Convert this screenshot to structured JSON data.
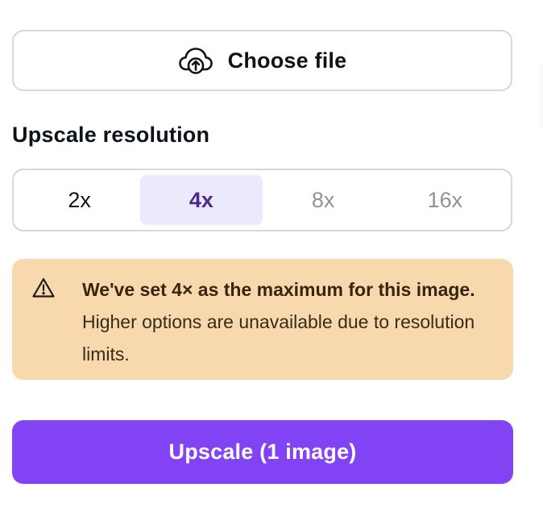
{
  "upload": {
    "choose_file_label": "Choose file",
    "icon": "cloud-upload-icon"
  },
  "resolution": {
    "title": "Upscale resolution",
    "options": [
      {
        "label": "2x",
        "state": "enabled"
      },
      {
        "label": "4x",
        "state": "selected"
      },
      {
        "label": "8x",
        "state": "disabled"
      },
      {
        "label": "16x",
        "state": "disabled"
      }
    ]
  },
  "notice": {
    "icon": "warning-icon",
    "headline": "We've set 4× as the maximum for this image.",
    "body": "Higher options are unavailable due to resolution limits.",
    "background": "#f7d9ad"
  },
  "action": {
    "upscale_label": "Upscale (1 image)",
    "color": "#8143f4"
  },
  "colors": {
    "accent": "#8143f4",
    "selected_bg": "#ece9fc",
    "selected_text": "#4b2a8f",
    "disabled_text": "#8e9196",
    "border": "#d6d8db"
  }
}
